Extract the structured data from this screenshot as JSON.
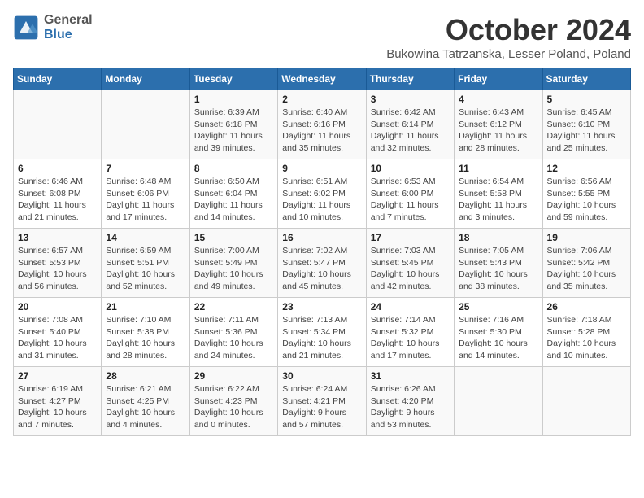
{
  "logo": {
    "general": "General",
    "blue": "Blue"
  },
  "title": "October 2024",
  "subtitle": "Bukowina Tatrzanska, Lesser Poland, Poland",
  "headers": [
    "Sunday",
    "Monday",
    "Tuesday",
    "Wednesday",
    "Thursday",
    "Friday",
    "Saturday"
  ],
  "weeks": [
    [
      {
        "day": "",
        "info": ""
      },
      {
        "day": "",
        "info": ""
      },
      {
        "day": "1",
        "info": "Sunrise: 6:39 AM\nSunset: 6:18 PM\nDaylight: 11 hours\nand 39 minutes."
      },
      {
        "day": "2",
        "info": "Sunrise: 6:40 AM\nSunset: 6:16 PM\nDaylight: 11 hours\nand 35 minutes."
      },
      {
        "day": "3",
        "info": "Sunrise: 6:42 AM\nSunset: 6:14 PM\nDaylight: 11 hours\nand 32 minutes."
      },
      {
        "day": "4",
        "info": "Sunrise: 6:43 AM\nSunset: 6:12 PM\nDaylight: 11 hours\nand 28 minutes."
      },
      {
        "day": "5",
        "info": "Sunrise: 6:45 AM\nSunset: 6:10 PM\nDaylight: 11 hours\nand 25 minutes."
      }
    ],
    [
      {
        "day": "6",
        "info": "Sunrise: 6:46 AM\nSunset: 6:08 PM\nDaylight: 11 hours\nand 21 minutes."
      },
      {
        "day": "7",
        "info": "Sunrise: 6:48 AM\nSunset: 6:06 PM\nDaylight: 11 hours\nand 17 minutes."
      },
      {
        "day": "8",
        "info": "Sunrise: 6:50 AM\nSunset: 6:04 PM\nDaylight: 11 hours\nand 14 minutes."
      },
      {
        "day": "9",
        "info": "Sunrise: 6:51 AM\nSunset: 6:02 PM\nDaylight: 11 hours\nand 10 minutes."
      },
      {
        "day": "10",
        "info": "Sunrise: 6:53 AM\nSunset: 6:00 PM\nDaylight: 11 hours\nand 7 minutes."
      },
      {
        "day": "11",
        "info": "Sunrise: 6:54 AM\nSunset: 5:58 PM\nDaylight: 11 hours\nand 3 minutes."
      },
      {
        "day": "12",
        "info": "Sunrise: 6:56 AM\nSunset: 5:55 PM\nDaylight: 10 hours\nand 59 minutes."
      }
    ],
    [
      {
        "day": "13",
        "info": "Sunrise: 6:57 AM\nSunset: 5:53 PM\nDaylight: 10 hours\nand 56 minutes."
      },
      {
        "day": "14",
        "info": "Sunrise: 6:59 AM\nSunset: 5:51 PM\nDaylight: 10 hours\nand 52 minutes."
      },
      {
        "day": "15",
        "info": "Sunrise: 7:00 AM\nSunset: 5:49 PM\nDaylight: 10 hours\nand 49 minutes."
      },
      {
        "day": "16",
        "info": "Sunrise: 7:02 AM\nSunset: 5:47 PM\nDaylight: 10 hours\nand 45 minutes."
      },
      {
        "day": "17",
        "info": "Sunrise: 7:03 AM\nSunset: 5:45 PM\nDaylight: 10 hours\nand 42 minutes."
      },
      {
        "day": "18",
        "info": "Sunrise: 7:05 AM\nSunset: 5:43 PM\nDaylight: 10 hours\nand 38 minutes."
      },
      {
        "day": "19",
        "info": "Sunrise: 7:06 AM\nSunset: 5:42 PM\nDaylight: 10 hours\nand 35 minutes."
      }
    ],
    [
      {
        "day": "20",
        "info": "Sunrise: 7:08 AM\nSunset: 5:40 PM\nDaylight: 10 hours\nand 31 minutes."
      },
      {
        "day": "21",
        "info": "Sunrise: 7:10 AM\nSunset: 5:38 PM\nDaylight: 10 hours\nand 28 minutes."
      },
      {
        "day": "22",
        "info": "Sunrise: 7:11 AM\nSunset: 5:36 PM\nDaylight: 10 hours\nand 24 minutes."
      },
      {
        "day": "23",
        "info": "Sunrise: 7:13 AM\nSunset: 5:34 PM\nDaylight: 10 hours\nand 21 minutes."
      },
      {
        "day": "24",
        "info": "Sunrise: 7:14 AM\nSunset: 5:32 PM\nDaylight: 10 hours\nand 17 minutes."
      },
      {
        "day": "25",
        "info": "Sunrise: 7:16 AM\nSunset: 5:30 PM\nDaylight: 10 hours\nand 14 minutes."
      },
      {
        "day": "26",
        "info": "Sunrise: 7:18 AM\nSunset: 5:28 PM\nDaylight: 10 hours\nand 10 minutes."
      }
    ],
    [
      {
        "day": "27",
        "info": "Sunrise: 6:19 AM\nSunset: 4:27 PM\nDaylight: 10 hours\nand 7 minutes."
      },
      {
        "day": "28",
        "info": "Sunrise: 6:21 AM\nSunset: 4:25 PM\nDaylight: 10 hours\nand 4 minutes."
      },
      {
        "day": "29",
        "info": "Sunrise: 6:22 AM\nSunset: 4:23 PM\nDaylight: 10 hours\nand 0 minutes."
      },
      {
        "day": "30",
        "info": "Sunrise: 6:24 AM\nSunset: 4:21 PM\nDaylight: 9 hours\nand 57 minutes."
      },
      {
        "day": "31",
        "info": "Sunrise: 6:26 AM\nSunset: 4:20 PM\nDaylight: 9 hours\nand 53 minutes."
      },
      {
        "day": "",
        "info": ""
      },
      {
        "day": "",
        "info": ""
      }
    ]
  ]
}
